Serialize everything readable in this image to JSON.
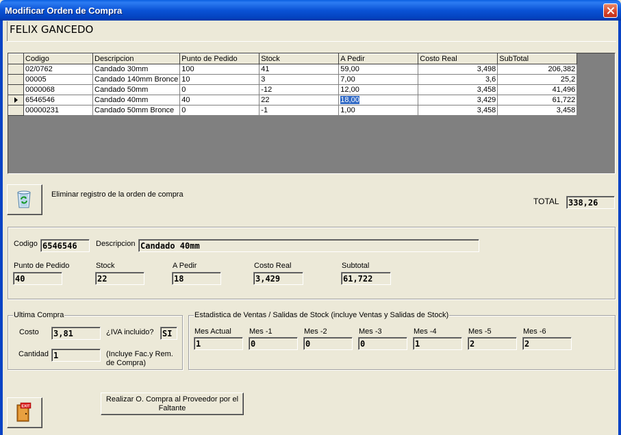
{
  "window": {
    "title": "Modificar Orden de Compra"
  },
  "provider": {
    "name": "FELIX GANCEDO"
  },
  "grid": {
    "columns": [
      "Codigo",
      "Descripcion",
      "Punto de Pedido",
      "Stock",
      "A Pedir",
      "Costo Real",
      "SubTotal"
    ],
    "rows": [
      {
        "codigo": "02/0762",
        "descripcion": "Candado 30mm",
        "punto": "100",
        "stock": "41",
        "apedir": "59,00",
        "costo": "3,498",
        "subtotal": "206,382"
      },
      {
        "codigo": "00005",
        "descripcion": "Candado 140mm Bronce",
        "punto": "10",
        "stock": "3",
        "apedir": "7,00",
        "costo": "3,6",
        "subtotal": "25,2"
      },
      {
        "codigo": "0000068",
        "descripcion": "Candado 50mm",
        "punto": "0",
        "stock": "-12",
        "apedir": "12,00",
        "costo": "3,458",
        "subtotal": "41,496"
      },
      {
        "codigo": "6546546",
        "descripcion": "Candado 40mm",
        "punto": "40",
        "stock": "22",
        "apedir": "18,00",
        "costo": "3,429",
        "subtotal": "61,722"
      },
      {
        "codigo": "00000231",
        "descripcion": "Candado 50mm Bronce",
        "punto": "0",
        "stock": "-1",
        "apedir": "1,00",
        "costo": "3,458",
        "subtotal": "3,458"
      }
    ],
    "selected_row": 3
  },
  "delete": {
    "label": "Eliminar registro de la orden de compra",
    "icon": "recycle-bin-icon"
  },
  "total": {
    "label": "TOTAL",
    "value": "338,26"
  },
  "detail": {
    "codigo_label": "Codigo",
    "codigo": "6546546",
    "descripcion_label": "Descripcion",
    "descripcion": "Candado 40mm",
    "punto_label": "Punto de Pedido",
    "punto": "40",
    "stock_label": "Stock",
    "stock": "22",
    "apedir_label": "A Pedir",
    "apedir": "18",
    "costo_label": "Costo Real",
    "costo": "3,429",
    "subtotal_label": "Subtotal",
    "subtotal": "61,722"
  },
  "ultima": {
    "title": "Ultima Compra",
    "costo_label": "Costo",
    "costo": "3,81",
    "iva_label": "¿IVA incluido?",
    "iva": "SI",
    "cantidad_label": "Cantidad",
    "cantidad": "1",
    "note": "(Incluye Fac.y Rem. de Compra)"
  },
  "estadistica": {
    "title": "Estadistica de Ventas / Salidas de Stock (incluye Ventas y Salidas de Stock)",
    "months": [
      {
        "label": "Mes Actual",
        "value": "1"
      },
      {
        "label": "Mes -1",
        "value": "0"
      },
      {
        "label": "Mes -2",
        "value": "0"
      },
      {
        "label": "Mes -3",
        "value": "0"
      },
      {
        "label": "Mes -4",
        "value": "1"
      },
      {
        "label": "Mes -5",
        "value": "2"
      },
      {
        "label": "Mes -6",
        "value": "2"
      }
    ]
  },
  "actions": {
    "realizar_label": "Realizar O. Compra al Proveedor por el Faltante",
    "exit_label": "EXIT"
  },
  "colors": {
    "titlebar": "#0a53d6",
    "face": "#ece9d8",
    "selection": "#316ac5"
  }
}
